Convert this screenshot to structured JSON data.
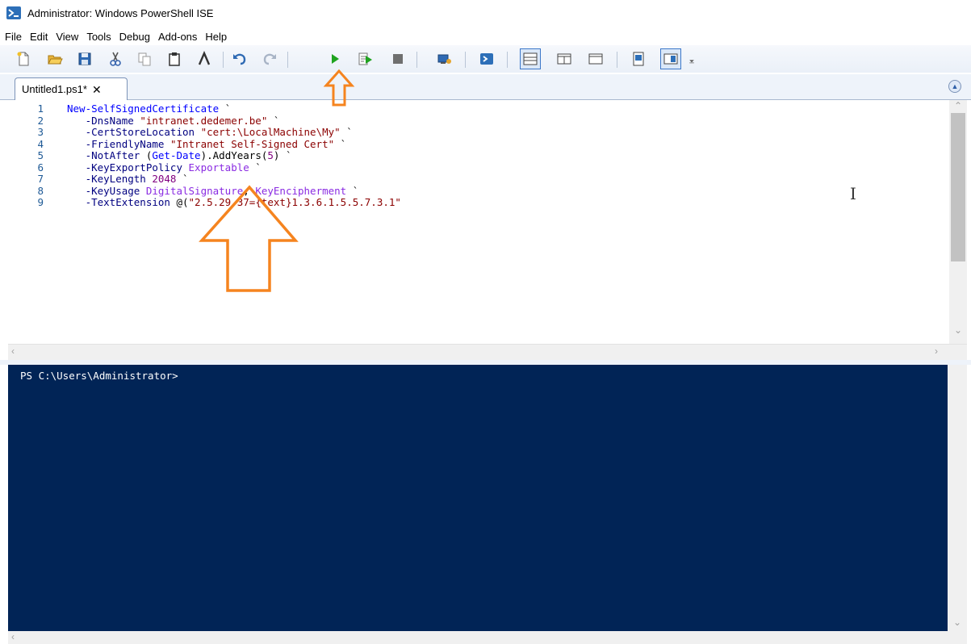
{
  "window": {
    "title": "Administrator: Windows PowerShell ISE"
  },
  "menu": [
    "File",
    "Edit",
    "View",
    "Tools",
    "Debug",
    "Add-ons",
    "Help"
  ],
  "tab": {
    "label": "Untitled1.ps1*",
    "close_glyph": "✕"
  },
  "editor": {
    "lines": [
      {
        "n": "1",
        "tokens": [
          {
            "t": "New-SelfSignedCertificate",
            "c": "cmd"
          },
          {
            "t": " `",
            "c": "plain"
          }
        ]
      },
      {
        "n": "2",
        "tokens": [
          {
            "t": "   -DnsName ",
            "c": "param"
          },
          {
            "t": "\"intranet.dedemer.be\"",
            "c": "str"
          },
          {
            "t": " `",
            "c": "plain"
          }
        ]
      },
      {
        "n": "3",
        "tokens": [
          {
            "t": "   -CertStoreLocation ",
            "c": "param"
          },
          {
            "t": "\"cert:\\LocalMachine\\My\"",
            "c": "str"
          },
          {
            "t": " `",
            "c": "plain"
          }
        ]
      },
      {
        "n": "4",
        "tokens": [
          {
            "t": "   -FriendlyName ",
            "c": "param"
          },
          {
            "t": "\"Intranet Self-Signed Cert\"",
            "c": "str"
          },
          {
            "t": " `",
            "c": "plain"
          }
        ]
      },
      {
        "n": "5",
        "tokens": [
          {
            "t": "   -NotAfter ",
            "c": "param"
          },
          {
            "t": "(",
            "c": "plain"
          },
          {
            "t": "Get-Date",
            "c": "cmd"
          },
          {
            "t": ").AddYears(",
            "c": "plain"
          },
          {
            "t": "5",
            "c": "num"
          },
          {
            "t": ")",
            "c": "plain"
          },
          {
            "t": " `",
            "c": "plain"
          }
        ]
      },
      {
        "n": "6",
        "tokens": [
          {
            "t": "   -KeyExportPolicy ",
            "c": "param"
          },
          {
            "t": "Exportable",
            "c": "type"
          },
          {
            "t": " `",
            "c": "plain"
          }
        ]
      },
      {
        "n": "7",
        "tokens": [
          {
            "t": "   -KeyLength ",
            "c": "param"
          },
          {
            "t": "2048",
            "c": "num"
          },
          {
            "t": " `",
            "c": "plain"
          }
        ]
      },
      {
        "n": "8",
        "tokens": [
          {
            "t": "   -KeyUsage ",
            "c": "param"
          },
          {
            "t": "DigitalSignature",
            "c": "type"
          },
          {
            "t": ", ",
            "c": "plain"
          },
          {
            "t": "KeyEncipherment",
            "c": "type"
          },
          {
            "t": " `",
            "c": "plain"
          }
        ]
      },
      {
        "n": "9",
        "tokens": [
          {
            "t": "   -TextExtension ",
            "c": "param"
          },
          {
            "t": "@(",
            "c": "plain"
          },
          {
            "t": "\"2.5.29.37={text}1.3.6.1.5.5.7.3.1\"",
            "c": "str"
          }
        ]
      }
    ]
  },
  "console": {
    "prompt": "PS C:\\Users\\Administrator>"
  },
  "colors": {
    "console_bg": "#012456",
    "annotation": "#f5841f",
    "run_green": "#1fa31f"
  },
  "toolbar_icons": [
    "new-icon",
    "open-icon",
    "save-icon",
    "cut-icon",
    "copy-icon",
    "paste-icon",
    "clear-console-icon",
    "undo-icon",
    "redo-icon",
    "run-script-icon",
    "run-selection-icon",
    "stop-icon",
    "remote-powershell-icon",
    "powershell-console-icon",
    "show-script-pane-top-icon",
    "show-script-pane-right-icon",
    "show-script-pane-maximized-icon",
    "show-script-pane-icon",
    "show-command-addon-icon"
  ]
}
